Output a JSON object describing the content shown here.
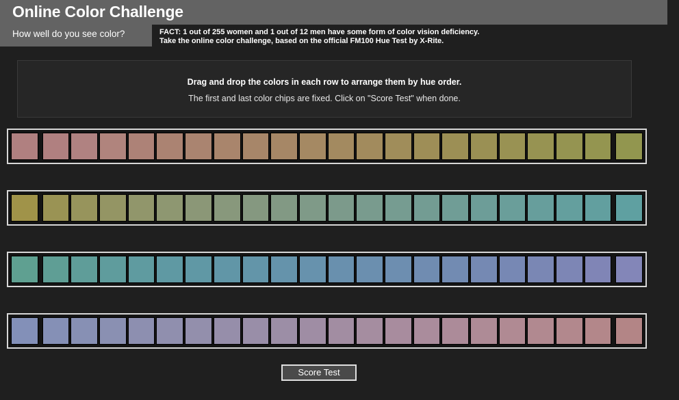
{
  "header": {
    "title": "Online Color Challenge",
    "subtitle": "How well do you see color?",
    "fact_line_1": "FACT: 1 out of 255 women and 1 out of 12 men have some form of color vision deficiency.",
    "fact_line_2": "Take the online color challenge, based on the official FM100 Hue Test by X-Rite."
  },
  "instructions": {
    "primary": "Drag and drop the colors in each row to arrange them by hue order.",
    "secondary": "The first and last color chips are fixed. Click on \"Score Test\" when done."
  },
  "colors": {
    "page_background": "#1f1f1f",
    "header_background": "#636363",
    "panel_background": "#262626",
    "row_border": "#d8d8d8",
    "row_background": "#141414",
    "button_background": "#4a4a4a",
    "button_border": "#e0e0e0",
    "text_primary": "#ffffff"
  },
  "rows": [
    {
      "index": 1,
      "name": "row-rose-to-olive",
      "chip_count": 22,
      "chips": [
        "#b08080",
        "#b08080",
        "#b08281",
        "#b0847d",
        "#ad8277",
        "#ab8372",
        "#aa8470",
        "#a9856c",
        "#a78669",
        "#a68766",
        "#a58963",
        "#a38a60",
        "#a28b5d",
        "#a08d5a",
        "#9e8e57",
        "#9c8f55",
        "#9a9054",
        "#999253",
        "#979352",
        "#959451",
        "#949550",
        "#92964f"
      ]
    },
    {
      "index": 2,
      "name": "row-olive-to-teal",
      "chip_count": 22,
      "chips": [
        "#a09349",
        "#9a9354",
        "#97945c",
        "#949564",
        "#91966b",
        "#8e9771",
        "#8b9777",
        "#88987c",
        "#859880",
        "#829984",
        "#7f9a88",
        "#7c9a8b",
        "#799b8e",
        "#769c91",
        "#739c93",
        "#709d96",
        "#6d9d98",
        "#6a9e9a",
        "#679e9c",
        "#649f9e",
        "#629f9f",
        "#5fa0a1"
      ]
    },
    {
      "index": 3,
      "name": "row-teal-to-blue",
      "chip_count": 22,
      "chips": [
        "#5fa091",
        "#5f9e95",
        "#5f9d99",
        "#5f9c9d",
        "#5f9ba0",
        "#5f99a3",
        "#6098a5",
        "#6196a7",
        "#6395a9",
        "#6593ab",
        "#6792ad",
        "#6990ae",
        "#6b8faf",
        "#6d8eb0",
        "#708cb1",
        "#728bb2",
        "#7589b3",
        "#7788b4",
        "#7a87b4",
        "#7d86b5",
        "#8085b6",
        "#8386b8"
      ]
    },
    {
      "index": 4,
      "name": "row-blue-to-rose",
      "chip_count": 22,
      "chips": [
        "#8390b8",
        "#8590b6",
        "#8790b4",
        "#8a90b2",
        "#8d8fb0",
        "#908fae",
        "#938fac",
        "#968eaa",
        "#998ea8",
        "#9c8ea6",
        "#9f8da4",
        "#a28da2",
        "#a58da0",
        "#a88c9e",
        "#aa8c9c",
        "#ac8b99",
        "#ae8b96",
        "#b08a93",
        "#b18990",
        "#b2888d",
        "#b3878a",
        "#b38586"
      ]
    }
  ],
  "button": {
    "label": "Score Test"
  }
}
